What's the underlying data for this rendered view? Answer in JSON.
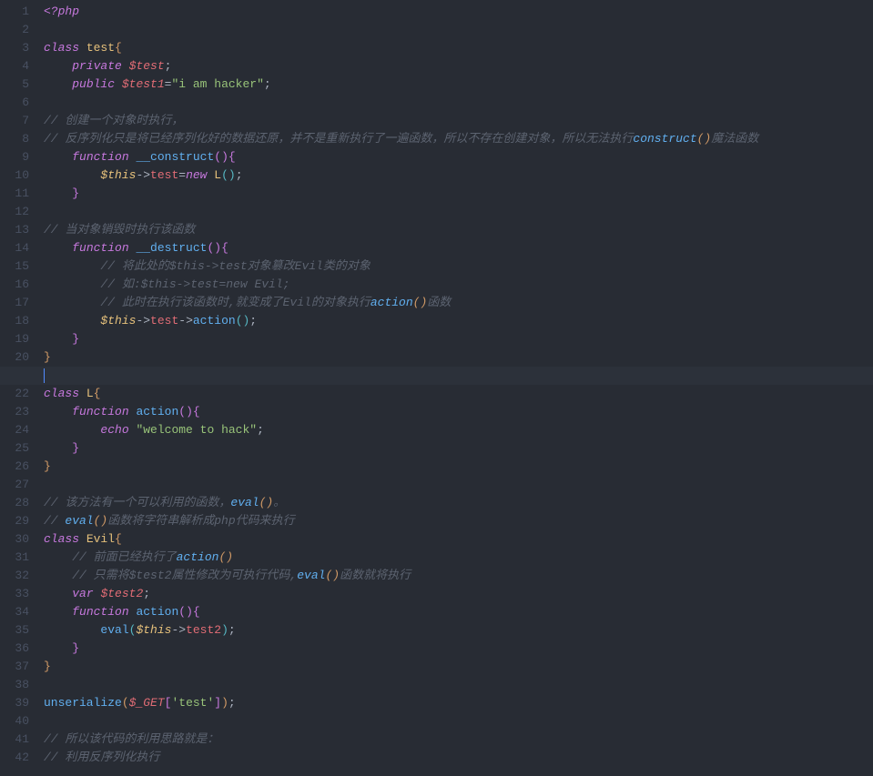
{
  "lineCount": 42,
  "currentLine": 21,
  "code": {
    "l1": [
      [
        "<?",
        "php"
      ],
      [
        "php",
        "php"
      ]
    ],
    "l2": [],
    "l3": [
      [
        "class",
        "keyword"
      ],
      [
        " ",
        "default"
      ],
      [
        "test",
        "class"
      ],
      [
        "{",
        "brace"
      ]
    ],
    "l4": [
      [
        "    ",
        "default"
      ],
      [
        "private",
        "keyword"
      ],
      [
        " ",
        "default"
      ],
      [
        "$test",
        "var"
      ],
      [
        ";",
        "punct"
      ]
    ],
    "l5": [
      [
        "    ",
        "default"
      ],
      [
        "public",
        "keyword"
      ],
      [
        " ",
        "default"
      ],
      [
        "$test1",
        "var"
      ],
      [
        "=",
        "op"
      ],
      [
        "\"i am hacker\"",
        "string"
      ],
      [
        ";",
        "punct"
      ]
    ],
    "l6": [],
    "l7": [
      [
        "// 创建一个对象时执行，",
        "comment"
      ]
    ],
    "l8": [
      [
        "// 反序列化只是将已经序列化好的数据还原，并不是重新执行了一遍函数，所以不存在创建对象，所以无法执行",
        "comment"
      ],
      [
        "construct",
        "cmtfunc"
      ],
      [
        "()",
        "cmtbrace"
      ],
      [
        "魔法函数",
        "comment"
      ]
    ],
    "l9": [
      [
        "    ",
        "default"
      ],
      [
        "function",
        "keyword"
      ],
      [
        " ",
        "default"
      ],
      [
        "__construct",
        "func"
      ],
      [
        "()",
        "brace2"
      ],
      [
        "{",
        "brace2"
      ]
    ],
    "l10": [
      [
        "        ",
        "default"
      ],
      [
        "$this",
        "varth"
      ],
      [
        "->",
        "op"
      ],
      [
        "test",
        "prop"
      ],
      [
        "=",
        "op"
      ],
      [
        "new",
        "keyword"
      ],
      [
        " ",
        "default"
      ],
      [
        "L",
        "class"
      ],
      [
        "()",
        "brace3"
      ],
      [
        ";",
        "punct"
      ]
    ],
    "l11": [
      [
        "    ",
        "default"
      ],
      [
        "}",
        "brace2"
      ]
    ],
    "l12": [],
    "l13": [
      [
        "// 当对象销毁时执行该函数",
        "comment"
      ]
    ],
    "l14": [
      [
        "    ",
        "default"
      ],
      [
        "function",
        "keyword"
      ],
      [
        " ",
        "default"
      ],
      [
        "__destruct",
        "func"
      ],
      [
        "()",
        "brace2"
      ],
      [
        "{",
        "brace2"
      ]
    ],
    "l15": [
      [
        "        ",
        "default"
      ],
      [
        "// 将此处的$this->test对象篡改Evil类的对象",
        "comment"
      ]
    ],
    "l16": [
      [
        "        ",
        "default"
      ],
      [
        "// 如:$this->test=new Evil;",
        "comment"
      ]
    ],
    "l17": [
      [
        "        ",
        "default"
      ],
      [
        "// 此时在执行该函数时,就变成了Evil的对象执行",
        "comment"
      ],
      [
        "action",
        "cmtfunc"
      ],
      [
        "()",
        "cmtbrace"
      ],
      [
        "函数",
        "comment"
      ]
    ],
    "l18": [
      [
        "        ",
        "default"
      ],
      [
        "$this",
        "varth"
      ],
      [
        "->",
        "op"
      ],
      [
        "test",
        "prop"
      ],
      [
        "->",
        "op"
      ],
      [
        "action",
        "func"
      ],
      [
        "()",
        "brace3"
      ],
      [
        ";",
        "punct"
      ]
    ],
    "l19": [
      [
        "    ",
        "default"
      ],
      [
        "}",
        "brace2"
      ]
    ],
    "l20": [
      [
        "}",
        "brace"
      ]
    ],
    "l21": [],
    "l22": [
      [
        "class",
        "keyword"
      ],
      [
        " ",
        "default"
      ],
      [
        "L",
        "class"
      ],
      [
        "{",
        "brace"
      ]
    ],
    "l23": [
      [
        "    ",
        "default"
      ],
      [
        "function",
        "keyword"
      ],
      [
        " ",
        "default"
      ],
      [
        "action",
        "func"
      ],
      [
        "()",
        "brace2"
      ],
      [
        "{",
        "brace2"
      ]
    ],
    "l24": [
      [
        "        ",
        "default"
      ],
      [
        "echo",
        "keyword"
      ],
      [
        " ",
        "default"
      ],
      [
        "\"welcome to hack\"",
        "string"
      ],
      [
        ";",
        "punct"
      ]
    ],
    "l25": [
      [
        "    ",
        "default"
      ],
      [
        "}",
        "brace2"
      ]
    ],
    "l26": [
      [
        "}",
        "brace"
      ]
    ],
    "l27": [],
    "l28": [
      [
        "// 该方法有一个可以利用的函数，",
        "comment"
      ],
      [
        "eval",
        "cmtfunc"
      ],
      [
        "()",
        "cmtbrace"
      ],
      [
        "。",
        "comment"
      ]
    ],
    "l29": [
      [
        "// ",
        "comment"
      ],
      [
        "eval",
        "cmtfunc"
      ],
      [
        "()",
        "cmtbrace"
      ],
      [
        "函数将字符串解析成php代码来执行",
        "comment"
      ]
    ],
    "l30": [
      [
        "class",
        "keyword"
      ],
      [
        " ",
        "default"
      ],
      [
        "Evil",
        "class"
      ],
      [
        "{",
        "brace"
      ]
    ],
    "l31": [
      [
        "    ",
        "default"
      ],
      [
        "// 前面已经执行了",
        "comment"
      ],
      [
        "action",
        "cmtfunc"
      ],
      [
        "()",
        "cmtbrace"
      ]
    ],
    "l32": [
      [
        "    ",
        "default"
      ],
      [
        "// 只需将$test2属性修改为可执行代码,",
        "comment"
      ],
      [
        "eval",
        "cmtfunc"
      ],
      [
        "()",
        "cmtbrace"
      ],
      [
        "函数就将执行",
        "comment"
      ]
    ],
    "l33": [
      [
        "    ",
        "default"
      ],
      [
        "var",
        "keyword"
      ],
      [
        " ",
        "default"
      ],
      [
        "$test2",
        "var"
      ],
      [
        ";",
        "punct"
      ]
    ],
    "l34": [
      [
        "    ",
        "default"
      ],
      [
        "function",
        "keyword"
      ],
      [
        " ",
        "default"
      ],
      [
        "action",
        "func"
      ],
      [
        "()",
        "brace2"
      ],
      [
        "{",
        "brace2"
      ]
    ],
    "l35": [
      [
        "        ",
        "default"
      ],
      [
        "eval",
        "func"
      ],
      [
        "(",
        "brace3"
      ],
      [
        "$this",
        "varth"
      ],
      [
        "->",
        "op"
      ],
      [
        "test2",
        "prop"
      ],
      [
        ")",
        "brace3"
      ],
      [
        ";",
        "punct"
      ]
    ],
    "l36": [
      [
        "    ",
        "default"
      ],
      [
        "}",
        "brace2"
      ]
    ],
    "l37": [
      [
        "}",
        "brace"
      ]
    ],
    "l38": [],
    "l39": [
      [
        "unserialize",
        "func"
      ],
      [
        "(",
        "brace"
      ],
      [
        "$_GET",
        "var"
      ],
      [
        "[",
        "brace2"
      ],
      [
        "'test'",
        "string"
      ],
      [
        "]",
        "brace2"
      ],
      [
        ")",
        "brace"
      ],
      [
        ";",
        "punct"
      ]
    ],
    "l40": [],
    "l41": [
      [
        "// 所以该代码的利用思路就是：",
        "comment"
      ]
    ],
    "l42": [
      [
        "// 利用反序列化执行",
        "comment"
      ]
    ]
  }
}
